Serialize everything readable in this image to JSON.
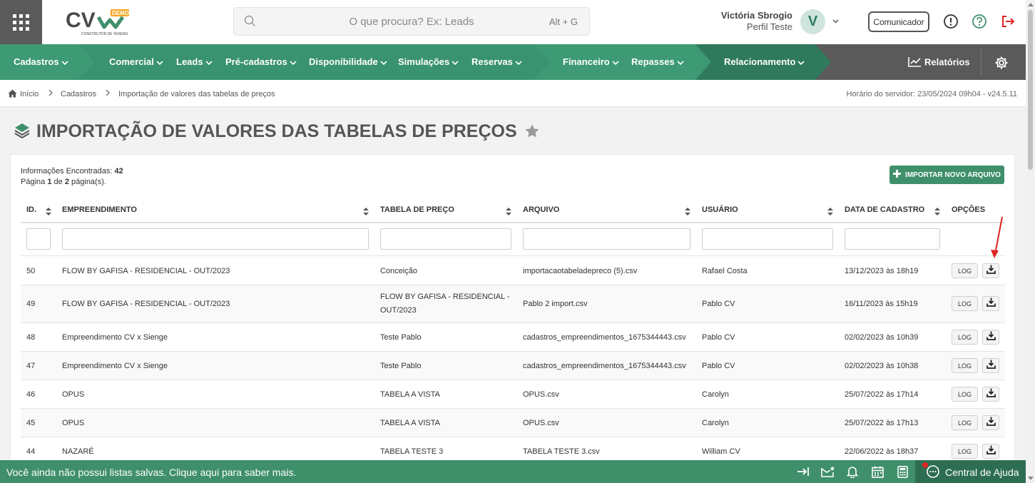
{
  "header": {
    "logo_text": "CV",
    "logo_badge": "DEMO",
    "logo_sub": "CONSTRUTOR DE VENDAS",
    "search_placeholder": "O que procura? Ex: Leads",
    "search_shortcut": "Alt + G",
    "user_name": "Victória Sbrogio",
    "user_profile": "Perfil Teste",
    "avatar_initial": "V",
    "comunicador_label": "Comunicador"
  },
  "nav": {
    "items": [
      "Cadastros",
      "Comercial",
      "Leads",
      "Pré-cadastros",
      "Disponibilidade",
      "Simulações",
      "Reservas",
      "Financeiro",
      "Repasses",
      "Relacionamento"
    ],
    "reports_label": "Relatórios"
  },
  "breadcrumb": {
    "items": [
      "Início",
      "Cadastros",
      "Importação de valores das tabelas de preços"
    ],
    "server_time": "Horário do servidor: 23/05/2024 09h04 - v24.5.11"
  },
  "page": {
    "title": "IMPORTAÇÃO DE VALORES DAS TABELAS DE PREÇOS"
  },
  "list": {
    "info_label": "Informações Encontradas:",
    "info_count": "42",
    "page_label_1": "Página",
    "page_current": "1",
    "page_label_2": "de",
    "page_total": "2",
    "page_label_3": "página(s).",
    "import_button": "IMPORTAR NOVO ARQUIVO",
    "columns": [
      "ID.",
      "EMPREENDIMENTO",
      "TABELA DE PREÇO",
      "ARQUIVO",
      "USUÁRIO",
      "DATA DE CADASTRO",
      "OPÇÕES"
    ],
    "log_label": "LOG",
    "rows": [
      {
        "id": "50",
        "empreendimento": "FLOW BY GAFISA - RESIDENCIAL - OUT/2023",
        "tabela": "Conceição",
        "arquivo": "importacaotabeladepreco (5).csv",
        "usuario": "Rafael Costa",
        "data": "13/12/2023 às 18h19"
      },
      {
        "id": "49",
        "empreendimento": "FLOW BY GAFISA - RESIDENCIAL - OUT/2023",
        "tabela": "FLOW BY GAFISA - RESIDENCIAL - OUT/2023",
        "arquivo": "Pablo 2 import.csv",
        "usuario": "Pablo CV",
        "data": "16/11/2023 às 15h19"
      },
      {
        "id": "48",
        "empreendimento": "Empreendimento CV x Sienge",
        "tabela": "Teste Pablo",
        "arquivo": "cadastros_empreendimentos_1675344443.csv",
        "usuario": "Pablo CV",
        "data": "02/02/2023 às 10h39"
      },
      {
        "id": "47",
        "empreendimento": "Empreendimento CV x Sienge",
        "tabela": "Teste Pablo",
        "arquivo": "cadastros_empreendimentos_1675344443.csv",
        "usuario": "Pablo CV",
        "data": "02/02/2023 às 10h38"
      },
      {
        "id": "46",
        "empreendimento": "OPUS",
        "tabela": "TABELA A VISTA",
        "arquivo": "OPUS.csv",
        "usuario": "Carolyn",
        "data": "25/07/2022 às 17h14"
      },
      {
        "id": "45",
        "empreendimento": "OPUS",
        "tabela": "TABELA A VISTA",
        "arquivo": "OPUS.csv",
        "usuario": "Carolyn",
        "data": "25/07/2022 às 17h13"
      },
      {
        "id": "44",
        "empreendimento": "NAZARÉ",
        "tabela": "TABELA TESTE 3",
        "arquivo": "TABELA TESTE 3.csv",
        "usuario": "William CV",
        "data": "22/06/2022 às 18h37"
      }
    ]
  },
  "footer": {
    "message": "Você ainda não possui listas salvas. Clique aqui para saber mais.",
    "help_label": "Central de Ajuda"
  },
  "colors": {
    "brand_green": "#3f8f6b",
    "nav_green": "#3d9a75",
    "nav_dark": "#5a5a5a",
    "alert_red": "#e02424"
  }
}
